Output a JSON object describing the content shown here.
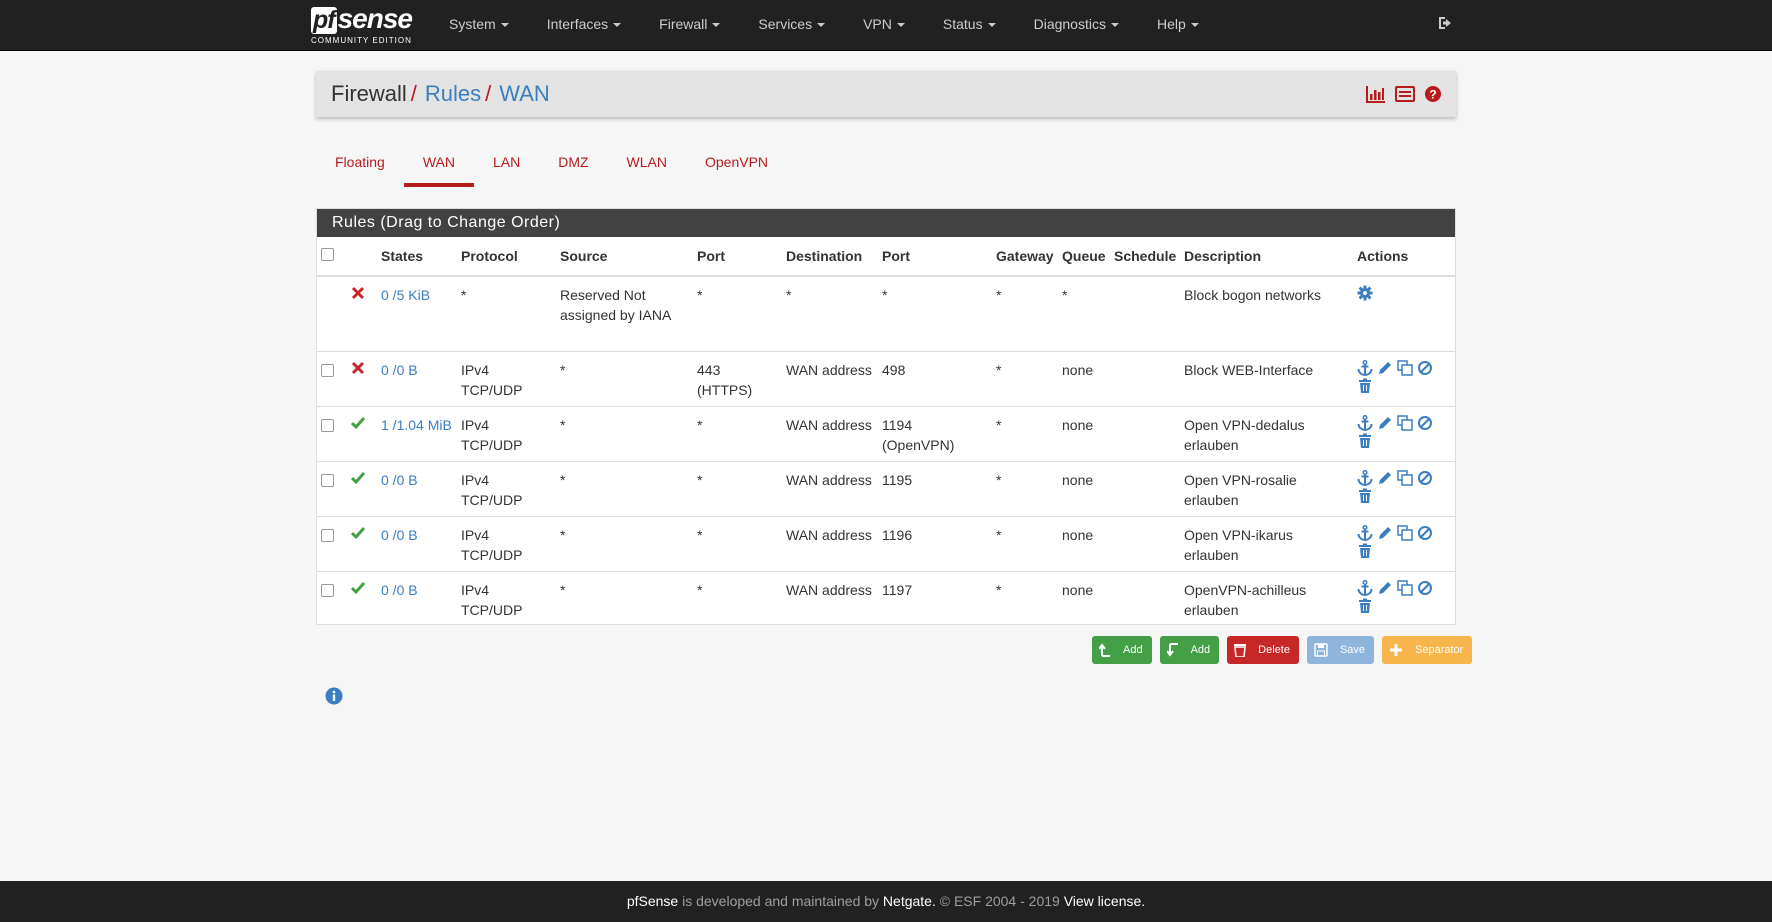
{
  "brand": {
    "logo_main": "sense",
    "logo_pf": "pf",
    "subtitle": "COMMUNITY EDITION"
  },
  "nav": {
    "items": [
      "System",
      "Interfaces",
      "Firewall",
      "Services",
      "VPN",
      "Status",
      "Diagnostics",
      "Help"
    ]
  },
  "breadcrumb": {
    "level1": "Firewall",
    "level2": "Rules",
    "level3": "WAN",
    "separator": "/"
  },
  "tabs": [
    "Floating",
    "WAN",
    "LAN",
    "DMZ",
    "WLAN",
    "OpenVPN"
  ],
  "active_tab": "WAN",
  "panel": {
    "title": "Rules (Drag to Change Order)",
    "columns": [
      "States",
      "Protocol",
      "Source",
      "Port",
      "Destination",
      "Port",
      "Gateway",
      "Queue",
      "Schedule",
      "Description",
      "Actions"
    ]
  },
  "rules": [
    {
      "status": "block",
      "states": "0 /5 KiB",
      "protocol": "*",
      "source": "Reserved Not assigned by IANA",
      "src_port": "*",
      "destination": "*",
      "dst_port": "*",
      "gateway": "*",
      "queue": "*",
      "schedule": "",
      "description": "Block bogon networks"
    },
    {
      "status": "block",
      "states": "0 /0 B",
      "protocol": "IPv4 TCP/UDP",
      "source": "*",
      "src_port": "443 (HTTPS)",
      "destination": "WAN address",
      "dst_port": "498",
      "gateway": "*",
      "queue": "none",
      "schedule": "",
      "description": "Block WEB-Interface"
    },
    {
      "status": "pass",
      "states": "1 /1.04 MiB",
      "protocol": "IPv4 TCP/UDP",
      "source": "*",
      "src_port": "*",
      "destination": "WAN address",
      "dst_port": "1194 (OpenVPN)",
      "gateway": "*",
      "queue": "none",
      "schedule": "",
      "description": "Open VPN-dedalus erlauben"
    },
    {
      "status": "pass",
      "states": "0 /0 B",
      "protocol": "IPv4 TCP/UDP",
      "source": "*",
      "src_port": "*",
      "destination": "WAN address",
      "dst_port": "1195",
      "gateway": "*",
      "queue": "none",
      "schedule": "",
      "description": "Open VPN-rosalie erlauben"
    },
    {
      "status": "pass",
      "states": "0 /0 B",
      "protocol": "IPv4 TCP/UDP",
      "source": "*",
      "src_port": "*",
      "destination": "WAN address",
      "dst_port": "1196",
      "gateway": "*",
      "queue": "none",
      "schedule": "",
      "description": "Open VPN-ikarus erlauben"
    },
    {
      "status": "pass",
      "states": "0 /0 B",
      "protocol": "IPv4 TCP/UDP",
      "source": "*",
      "src_port": "*",
      "destination": "WAN address",
      "dst_port": "1197",
      "gateway": "*",
      "queue": "none",
      "schedule": "",
      "description": "OpenVPN-achilleus erlauben"
    }
  ],
  "buttons": {
    "add_top": "Add",
    "add_bottom": "Add",
    "delete": "Delete",
    "save": "Save",
    "separator": "Separator"
  },
  "footer": {
    "product": "pfSense",
    "text1": " is developed and maintained by ",
    "company": "Netgate.",
    "text2": " © ESF 2004 - 2019 ",
    "license": "View license."
  },
  "colors": {
    "accent_red": "#b71c1c",
    "link_blue": "#3b7ec0",
    "pass_green": "#43a047",
    "navbar": "#212121"
  },
  "icons": [
    "logout-icon",
    "chart-icon",
    "list-icon",
    "help-icon",
    "gear-icon",
    "anchor-icon",
    "pencil-icon",
    "copy-icon",
    "disable-icon",
    "trash-icon",
    "info-icon"
  ]
}
